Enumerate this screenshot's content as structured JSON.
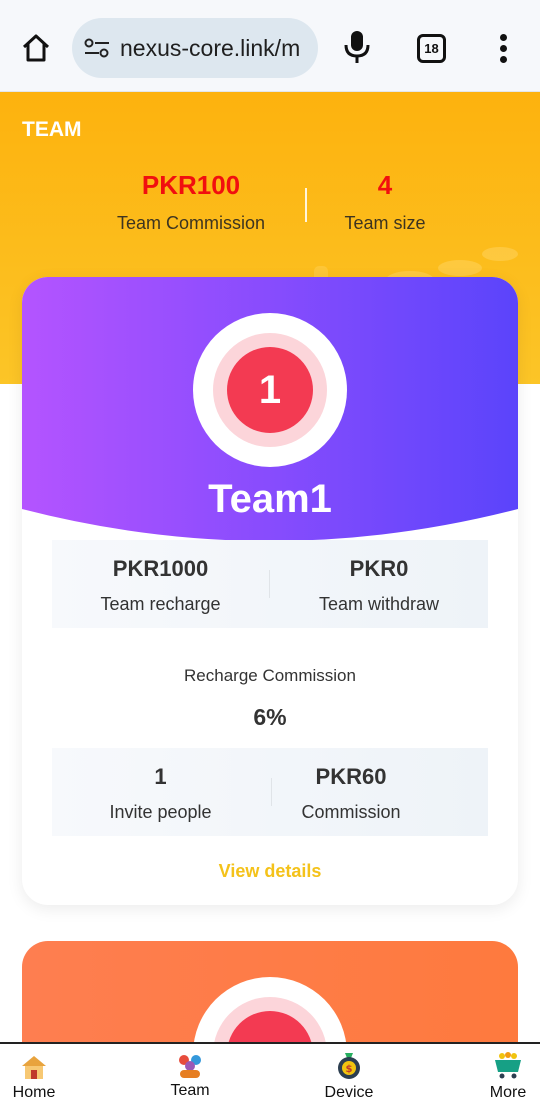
{
  "browser": {
    "url": "nexus-core.link/m",
    "tab_count": "18"
  },
  "header": {
    "title": "TEAM",
    "team_commission_value": "PKR100",
    "team_commission_label": "Team Commission",
    "team_size_value": "4",
    "team_size_label": "Team size"
  },
  "team_card": {
    "level": "1",
    "name": "Team1",
    "team_recharge_value": "PKR1000",
    "team_recharge_label": "Team recharge",
    "team_withdraw_value": "PKR0",
    "team_withdraw_label": "Team withdraw",
    "recharge_commission_label": "Recharge Commission",
    "recharge_commission_value": "6%",
    "invite_people_value": "1",
    "invite_people_label": "Invite people",
    "commission_value": "PKR60",
    "commission_label": "Commission",
    "view_details_label": "View details"
  },
  "bottom_nav": {
    "items": [
      {
        "label": "Home",
        "icon": "house-icon"
      },
      {
        "label": "Team",
        "icon": "team-icon"
      },
      {
        "label": "Device",
        "icon": "money-bag-icon"
      },
      {
        "label": "More",
        "icon": "cart-icon"
      }
    ]
  },
  "colors": {
    "header_yellow": "#fdb20e",
    "accent_red": "#f10f0f",
    "card_purple_start": "#b454ff",
    "card_purple_end": "#5b44fb",
    "link_yellow": "#f4c21a",
    "card2_orange": "#fe7e50"
  }
}
